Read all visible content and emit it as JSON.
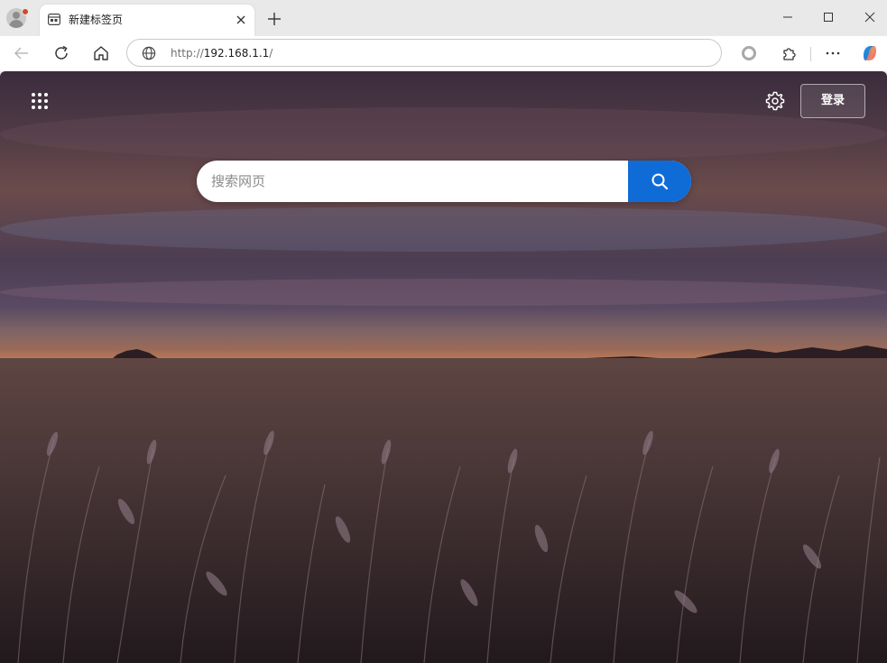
{
  "browser": {
    "tab": {
      "title": "新建标签页"
    },
    "address_bar": {
      "scheme": "http://",
      "host": "192.168.1.1",
      "path": "/"
    },
    "icons": {
      "profile": "profile-avatar-icon",
      "tab_favicon": "new-tab-page-icon",
      "tab_close": "close-icon",
      "new_tab": "plus-icon",
      "minimize": "minimize-icon",
      "maximize": "maximize-icon",
      "close_window": "close-window-icon",
      "back": "arrow-left-icon",
      "refresh": "refresh-icon",
      "home": "home-icon",
      "site_info": "globe-icon",
      "tracking": "circle-icon",
      "extensions": "puzzle-icon",
      "more": "more-dots-icon",
      "copilot": "copilot-icon"
    }
  },
  "new_tab_page": {
    "search": {
      "placeholder": "搜索网页",
      "value": ""
    },
    "login_label": "登录",
    "icons": {
      "apps": "apps-grid-icon",
      "settings": "gear-icon",
      "search": "search-icon"
    },
    "background": "wheat field at sunset"
  },
  "colors": {
    "accent": "#0f6cd6",
    "tabstrip": "#e9e9e9",
    "toolbar": "#ffffff"
  }
}
